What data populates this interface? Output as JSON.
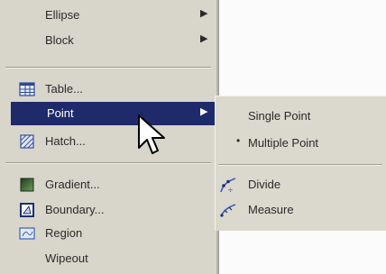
{
  "menu": {
    "items": [
      {
        "id": "ellipse",
        "label": "Ellipse",
        "submenu": true
      },
      {
        "id": "block",
        "label": "Block",
        "submenu": true
      },
      {
        "id": "table",
        "label": "Table...",
        "icon": "table-icon"
      },
      {
        "id": "point",
        "label": "Point",
        "submenu": true,
        "highlighted": true
      },
      {
        "id": "hatch",
        "label": "Hatch...",
        "icon": "hatch-icon"
      },
      {
        "id": "gradient",
        "label": "Gradient...",
        "icon": "gradient-icon"
      },
      {
        "id": "boundary",
        "label": "Boundary...",
        "icon": "boundary-icon"
      },
      {
        "id": "region",
        "label": "Region",
        "icon": "region-icon"
      },
      {
        "id": "wipeout",
        "label": "Wipeout"
      }
    ],
    "arrow_glyph": "▶"
  },
  "submenu": {
    "items": [
      {
        "id": "single-point",
        "label": "Single Point"
      },
      {
        "id": "multiple-point",
        "label": "Multiple Point",
        "bullet": "•"
      },
      {
        "id": "divide",
        "label": "Divide",
        "icon": "divide-icon"
      },
      {
        "id": "measure",
        "label": "Measure",
        "icon": "measure-icon"
      }
    ]
  },
  "colors": {
    "menu_bg": "#d8d5cb",
    "highlight": "#1f2a6b",
    "highlight_text": "#ffffff",
    "text": "#2a2a2a"
  },
  "cursor": "arrow-cursor"
}
